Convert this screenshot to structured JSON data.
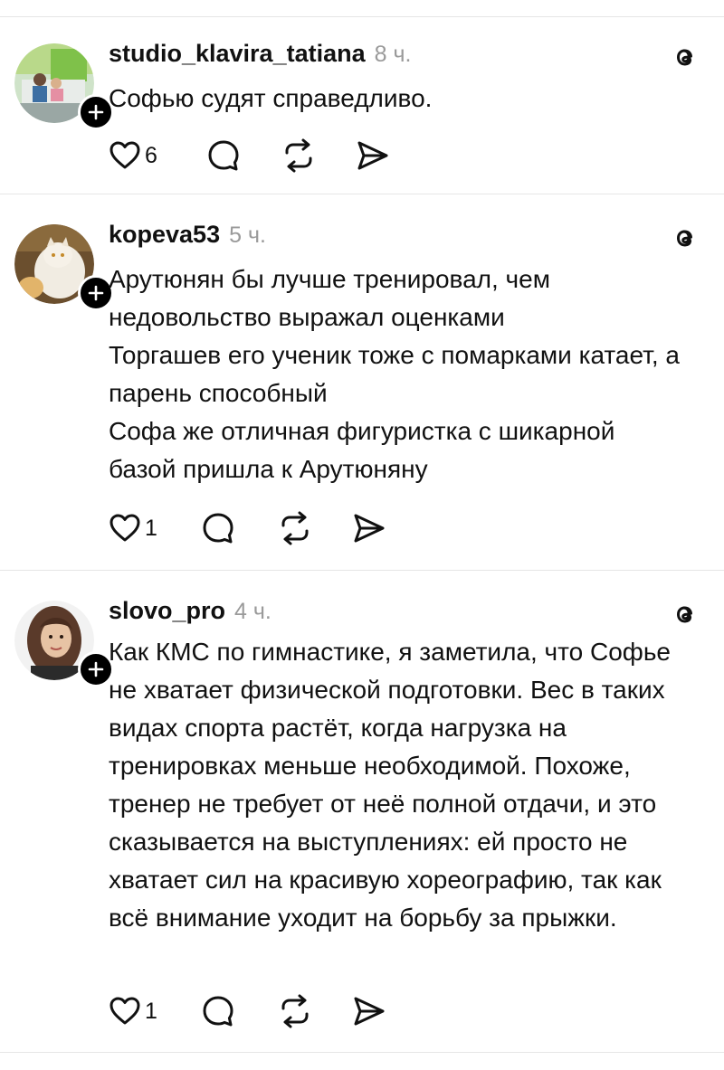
{
  "posts": [
    {
      "username": "studio_klavira_tatiana",
      "time": "8 ч.",
      "paragraphs": [
        "Софью судят справедливо."
      ],
      "likes": "6"
    },
    {
      "username": "kopeva53",
      "time": "5 ч.",
      "paragraphs": [
        "Арутюнян бы лучше тренировал, чем недовольство выражал оценками",
        "Торгашев его ученик тоже с помарками катает, а парень способный",
        "Софа же отличная фигуристка с шикарной базой пришла к Арутюняну"
      ],
      "likes": "1"
    },
    {
      "username": "slovo_pro",
      "time": "4 ч.",
      "paragraphs": [
        "Как КМС по гимнастике, я заметила, что Софье не хватает физической подготовки. Вес в таких видах спорта растёт, когда нагрузка на тренировках меньше необходимой. Похоже, тренер не требует от неё полной отдачи, и это сказывается на выступлениях: ей просто не хватает сил на красивую хореографию, так как всё внимание уходит на борьбу за прыжки."
      ],
      "likes": "1"
    }
  ],
  "icons": {
    "like": "heart-icon",
    "reply": "comment-bubble-icon",
    "repost": "repost-icon",
    "share": "share-send-icon",
    "platform": "threads-logo-icon",
    "follow": "plus-icon"
  }
}
